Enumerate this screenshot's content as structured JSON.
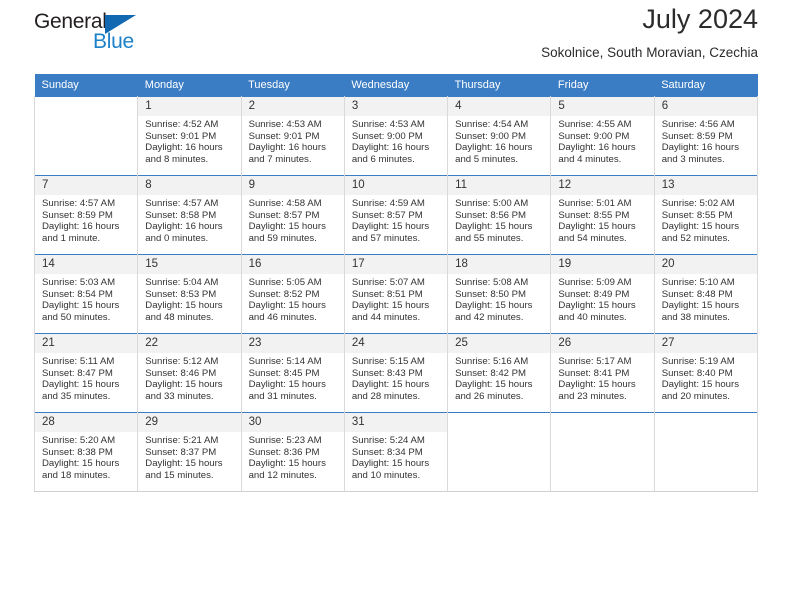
{
  "brand": {
    "name_part1": "General",
    "name_part2": "Blue",
    "triangle_icon": "triangle-icon",
    "accent_color": "#1368b2",
    "blue_color": "#1e81c9"
  },
  "header": {
    "title": "July 2024",
    "subtitle": "Sokolnice, South Moravian, Czechia"
  },
  "calendar": {
    "header_bg": "#3b7dc4",
    "daynum_bg": "#f2f2f2",
    "weekdays": [
      "Sunday",
      "Monday",
      "Tuesday",
      "Wednesday",
      "Thursday",
      "Friday",
      "Saturday"
    ],
    "labels": {
      "sunrise": "Sunrise:",
      "sunset": "Sunset:",
      "daylight": "Daylight:"
    },
    "weeks": [
      [
        {
          "day": "",
          "sunrise": "",
          "sunset": "",
          "daylight_1": "",
          "daylight_2": ""
        },
        {
          "day": "1",
          "sunrise": "Sunrise: 4:52 AM",
          "sunset": "Sunset: 9:01 PM",
          "daylight_1": "Daylight: 16 hours",
          "daylight_2": "and 8 minutes."
        },
        {
          "day": "2",
          "sunrise": "Sunrise: 4:53 AM",
          "sunset": "Sunset: 9:01 PM",
          "daylight_1": "Daylight: 16 hours",
          "daylight_2": "and 7 minutes."
        },
        {
          "day": "3",
          "sunrise": "Sunrise: 4:53 AM",
          "sunset": "Sunset: 9:00 PM",
          "daylight_1": "Daylight: 16 hours",
          "daylight_2": "and 6 minutes."
        },
        {
          "day": "4",
          "sunrise": "Sunrise: 4:54 AM",
          "sunset": "Sunset: 9:00 PM",
          "daylight_1": "Daylight: 16 hours",
          "daylight_2": "and 5 minutes."
        },
        {
          "day": "5",
          "sunrise": "Sunrise: 4:55 AM",
          "sunset": "Sunset: 9:00 PM",
          "daylight_1": "Daylight: 16 hours",
          "daylight_2": "and 4 minutes."
        },
        {
          "day": "6",
          "sunrise": "Sunrise: 4:56 AM",
          "sunset": "Sunset: 8:59 PM",
          "daylight_1": "Daylight: 16 hours",
          "daylight_2": "and 3 minutes."
        }
      ],
      [
        {
          "day": "7",
          "sunrise": "Sunrise: 4:57 AM",
          "sunset": "Sunset: 8:59 PM",
          "daylight_1": "Daylight: 16 hours",
          "daylight_2": "and 1 minute."
        },
        {
          "day": "8",
          "sunrise": "Sunrise: 4:57 AM",
          "sunset": "Sunset: 8:58 PM",
          "daylight_1": "Daylight: 16 hours",
          "daylight_2": "and 0 minutes."
        },
        {
          "day": "9",
          "sunrise": "Sunrise: 4:58 AM",
          "sunset": "Sunset: 8:57 PM",
          "daylight_1": "Daylight: 15 hours",
          "daylight_2": "and 59 minutes."
        },
        {
          "day": "10",
          "sunrise": "Sunrise: 4:59 AM",
          "sunset": "Sunset: 8:57 PM",
          "daylight_1": "Daylight: 15 hours",
          "daylight_2": "and 57 minutes."
        },
        {
          "day": "11",
          "sunrise": "Sunrise: 5:00 AM",
          "sunset": "Sunset: 8:56 PM",
          "daylight_1": "Daylight: 15 hours",
          "daylight_2": "and 55 minutes."
        },
        {
          "day": "12",
          "sunrise": "Sunrise: 5:01 AM",
          "sunset": "Sunset: 8:55 PM",
          "daylight_1": "Daylight: 15 hours",
          "daylight_2": "and 54 minutes."
        },
        {
          "day": "13",
          "sunrise": "Sunrise: 5:02 AM",
          "sunset": "Sunset: 8:55 PM",
          "daylight_1": "Daylight: 15 hours",
          "daylight_2": "and 52 minutes."
        }
      ],
      [
        {
          "day": "14",
          "sunrise": "Sunrise: 5:03 AM",
          "sunset": "Sunset: 8:54 PM",
          "daylight_1": "Daylight: 15 hours",
          "daylight_2": "and 50 minutes."
        },
        {
          "day": "15",
          "sunrise": "Sunrise: 5:04 AM",
          "sunset": "Sunset: 8:53 PM",
          "daylight_1": "Daylight: 15 hours",
          "daylight_2": "and 48 minutes."
        },
        {
          "day": "16",
          "sunrise": "Sunrise: 5:05 AM",
          "sunset": "Sunset: 8:52 PM",
          "daylight_1": "Daylight: 15 hours",
          "daylight_2": "and 46 minutes."
        },
        {
          "day": "17",
          "sunrise": "Sunrise: 5:07 AM",
          "sunset": "Sunset: 8:51 PM",
          "daylight_1": "Daylight: 15 hours",
          "daylight_2": "and 44 minutes."
        },
        {
          "day": "18",
          "sunrise": "Sunrise: 5:08 AM",
          "sunset": "Sunset: 8:50 PM",
          "daylight_1": "Daylight: 15 hours",
          "daylight_2": "and 42 minutes."
        },
        {
          "day": "19",
          "sunrise": "Sunrise: 5:09 AM",
          "sunset": "Sunset: 8:49 PM",
          "daylight_1": "Daylight: 15 hours",
          "daylight_2": "and 40 minutes."
        },
        {
          "day": "20",
          "sunrise": "Sunrise: 5:10 AM",
          "sunset": "Sunset: 8:48 PM",
          "daylight_1": "Daylight: 15 hours",
          "daylight_2": "and 38 minutes."
        }
      ],
      [
        {
          "day": "21",
          "sunrise": "Sunrise: 5:11 AM",
          "sunset": "Sunset: 8:47 PM",
          "daylight_1": "Daylight: 15 hours",
          "daylight_2": "and 35 minutes."
        },
        {
          "day": "22",
          "sunrise": "Sunrise: 5:12 AM",
          "sunset": "Sunset: 8:46 PM",
          "daylight_1": "Daylight: 15 hours",
          "daylight_2": "and 33 minutes."
        },
        {
          "day": "23",
          "sunrise": "Sunrise: 5:14 AM",
          "sunset": "Sunset: 8:45 PM",
          "daylight_1": "Daylight: 15 hours",
          "daylight_2": "and 31 minutes."
        },
        {
          "day": "24",
          "sunrise": "Sunrise: 5:15 AM",
          "sunset": "Sunset: 8:43 PM",
          "daylight_1": "Daylight: 15 hours",
          "daylight_2": "and 28 minutes."
        },
        {
          "day": "25",
          "sunrise": "Sunrise: 5:16 AM",
          "sunset": "Sunset: 8:42 PM",
          "daylight_1": "Daylight: 15 hours",
          "daylight_2": "and 26 minutes."
        },
        {
          "day": "26",
          "sunrise": "Sunrise: 5:17 AM",
          "sunset": "Sunset: 8:41 PM",
          "daylight_1": "Daylight: 15 hours",
          "daylight_2": "and 23 minutes."
        },
        {
          "day": "27",
          "sunrise": "Sunrise: 5:19 AM",
          "sunset": "Sunset: 8:40 PM",
          "daylight_1": "Daylight: 15 hours",
          "daylight_2": "and 20 minutes."
        }
      ],
      [
        {
          "day": "28",
          "sunrise": "Sunrise: 5:20 AM",
          "sunset": "Sunset: 8:38 PM",
          "daylight_1": "Daylight: 15 hours",
          "daylight_2": "and 18 minutes."
        },
        {
          "day": "29",
          "sunrise": "Sunrise: 5:21 AM",
          "sunset": "Sunset: 8:37 PM",
          "daylight_1": "Daylight: 15 hours",
          "daylight_2": "and 15 minutes."
        },
        {
          "day": "30",
          "sunrise": "Sunrise: 5:23 AM",
          "sunset": "Sunset: 8:36 PM",
          "daylight_1": "Daylight: 15 hours",
          "daylight_2": "and 12 minutes."
        },
        {
          "day": "31",
          "sunrise": "Sunrise: 5:24 AM",
          "sunset": "Sunset: 8:34 PM",
          "daylight_1": "Daylight: 15 hours",
          "daylight_2": "and 10 minutes."
        },
        {
          "day": "",
          "sunrise": "",
          "sunset": "",
          "daylight_1": "",
          "daylight_2": ""
        },
        {
          "day": "",
          "sunrise": "",
          "sunset": "",
          "daylight_1": "",
          "daylight_2": ""
        },
        {
          "day": "",
          "sunrise": "",
          "sunset": "",
          "daylight_1": "",
          "daylight_2": ""
        }
      ]
    ]
  }
}
